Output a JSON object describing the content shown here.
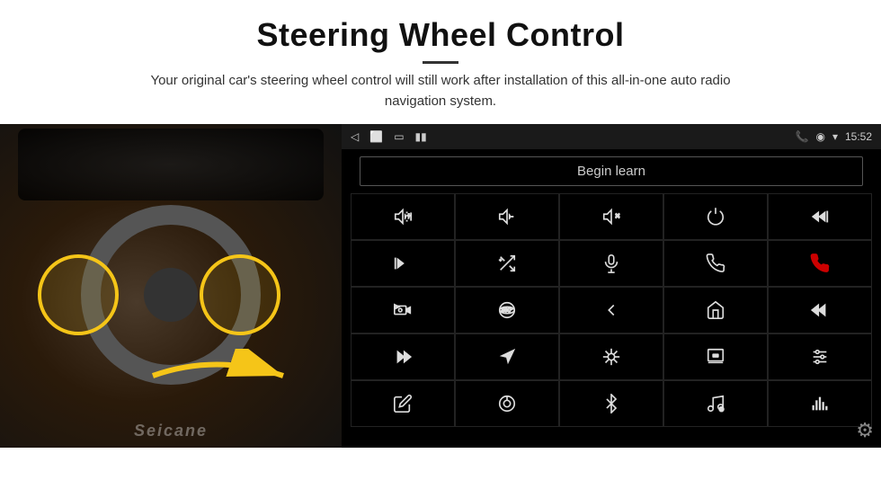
{
  "header": {
    "title": "Steering Wheel Control",
    "divider": true,
    "subtitle": "Your original car's steering wheel control will still work after installation of this all-in-one auto radio navigation system."
  },
  "status_bar": {
    "left": {
      "back_icon": "◁",
      "home_icon": "⬜",
      "recent_icon": "▭",
      "signal_icon": "▮▮"
    },
    "right": {
      "phone_icon": "📞",
      "location_icon": "◉",
      "wifi_icon": "▾",
      "time": "15:52"
    }
  },
  "begin_learn": {
    "label": "Begin learn"
  },
  "icon_grid": {
    "rows": [
      [
        "vol+",
        "vol-",
        "mute",
        "power",
        "prev-track"
      ],
      [
        "next",
        "shuffle",
        "mic",
        "phone",
        "end-call"
      ],
      [
        "camera",
        "360",
        "back",
        "home",
        "skip-back"
      ],
      [
        "fast-forward",
        "navigate",
        "eq",
        "media",
        "settings-sliders"
      ],
      [
        "edit",
        "knob",
        "bluetooth",
        "music",
        "sound-bars"
      ]
    ]
  },
  "watermark": "Seicane",
  "gear_icon": "⚙"
}
